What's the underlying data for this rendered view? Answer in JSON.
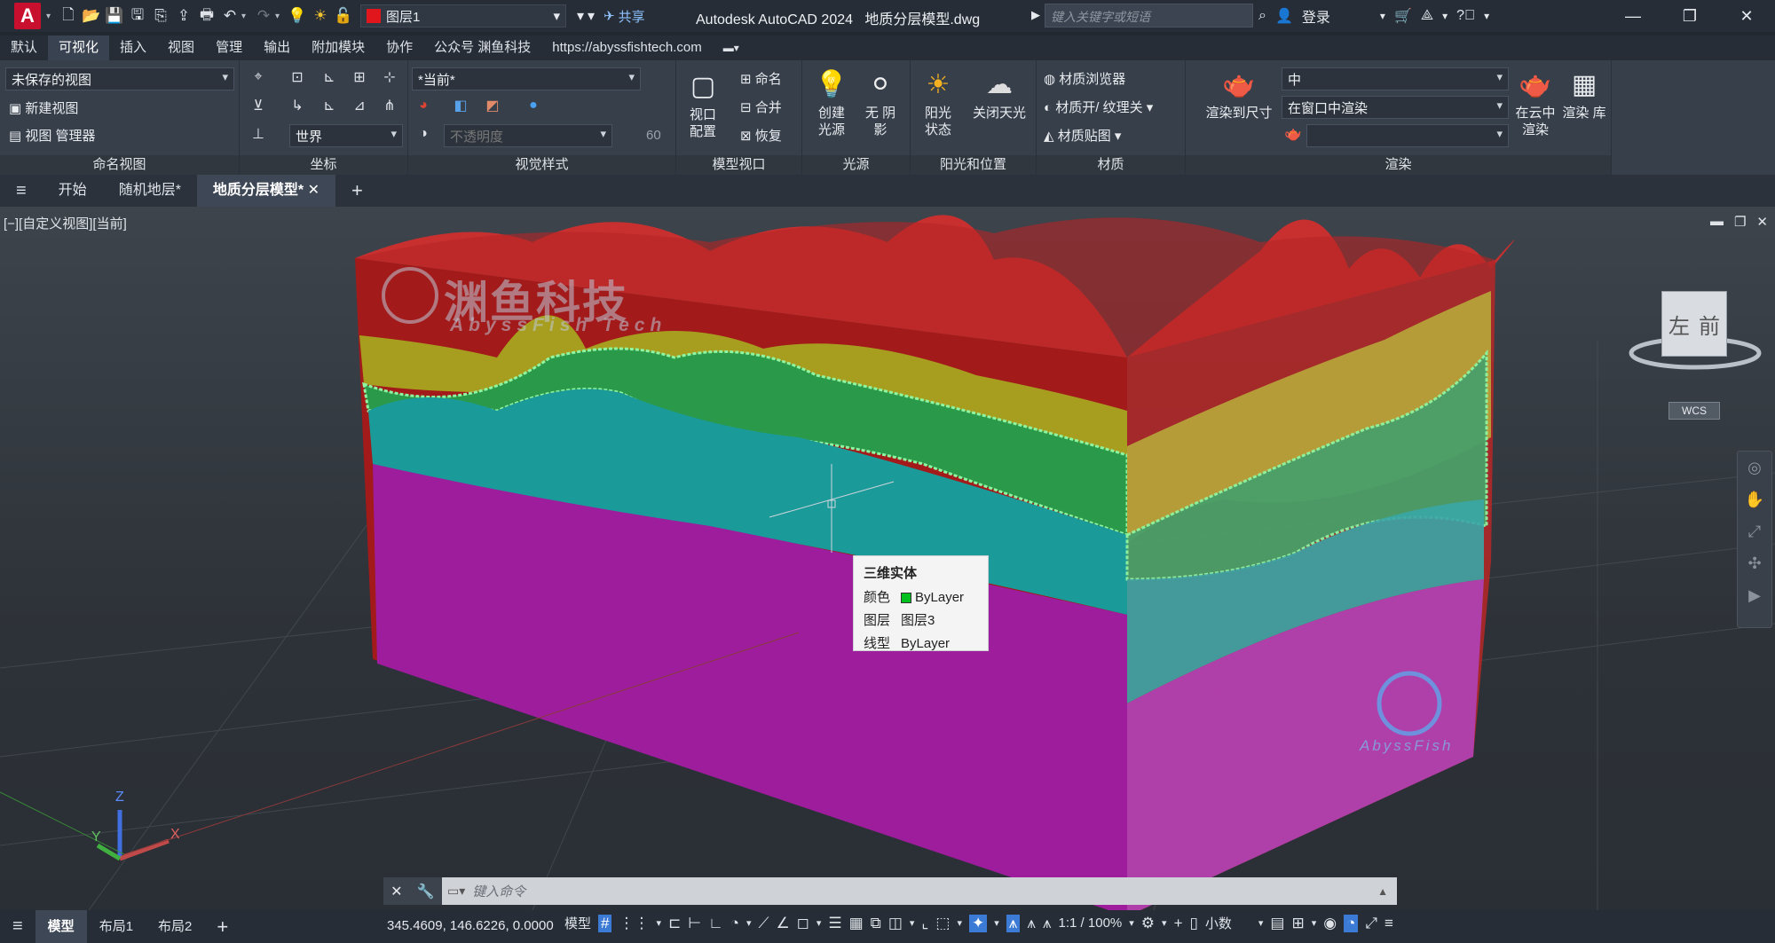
{
  "title_bar": {
    "app_title": "Autodesk AutoCAD 2024",
    "file_name": "地质分层模型.dwg",
    "layer": "图层1",
    "share": "共享",
    "search_placeholder": "键入关键字或短语",
    "login": "登录",
    "logo_letter": "A"
  },
  "menu_tabs": [
    "默认",
    "可视化",
    "插入",
    "视图",
    "管理",
    "输出",
    "附加模块",
    "协作",
    "公众号 渊鱼科技",
    "https://abyssfishtech.com"
  ],
  "active_menu_tab": "可视化",
  "ribbon": {
    "named_views": {
      "view_dd": "未保存的视图",
      "new_view": "新建视图",
      "view_manager": "视图 管理器",
      "title": "命名视图"
    },
    "coords": {
      "ucs_dd": "世界",
      "title": "坐标"
    },
    "visual_styles": {
      "style_dd": "*当前*",
      "opacity": "不透明度",
      "opacity_value": "60",
      "title": "视觉样式"
    },
    "model_viewports": {
      "viewport_config": "视口 配置",
      "name": "命名",
      "join": "合并",
      "restore": "恢复",
      "title": "模型视口"
    },
    "lights": {
      "create_light": "创建 光源",
      "no_shadow": "无 阴影",
      "title": "光源"
    },
    "sun": {
      "sun_status": "阳光 状态",
      "sky_off": "关闭天光",
      "title": "阳光和位置"
    },
    "materials": {
      "browser": "材质浏览器",
      "toggle": "材质开/ 纹理关",
      "mapping": "材质贴图",
      "title": "材质"
    },
    "render": {
      "render_to_size": "渲染到尺寸",
      "quality_dd": "中",
      "target_dd": "在窗口中渲染",
      "cloud_render": "在云中 渲染",
      "library": "渲染 库",
      "title": "渲染"
    }
  },
  "doc_tabs": [
    "开始",
    "随机地层*",
    "地质分层模型*"
  ],
  "active_doc_tab": "地质分层模型*",
  "viewport": {
    "label": "[−][自定义视图][当前]",
    "watermark_cn": "渊鱼科技",
    "watermark_en": "AbyssFish Tech",
    "watermark_small": "AbyssFish",
    "viewcube_left": "左",
    "viewcube_front": "前",
    "wcs": "WCS",
    "axes": {
      "x": "X",
      "y": "Y",
      "z": "Z"
    }
  },
  "tooltip": {
    "title": "三维实体",
    "rows": [
      {
        "label": "颜色",
        "value": "ByLayer",
        "swatch": "#00c020"
      },
      {
        "label": "图层",
        "value": "图层3"
      },
      {
        "label": "线型",
        "value": "ByLayer"
      }
    ]
  },
  "command_line": {
    "placeholder": "键入命令"
  },
  "status_bar": {
    "tabs": [
      "模型",
      "布局1",
      "布局2"
    ],
    "active_tab": "模型",
    "coordinates": "345.4609, 146.6226, 0.0000",
    "space": "模型",
    "scale": "1:1 / 100%",
    "units": "小数"
  },
  "colors": {
    "red": "#b41f1f",
    "yellow": "#b2a322",
    "green": "#2a9a4a",
    "teal": "#1d9a9a",
    "magenta": "#a020a0",
    "accent": "#3b7bd6"
  }
}
